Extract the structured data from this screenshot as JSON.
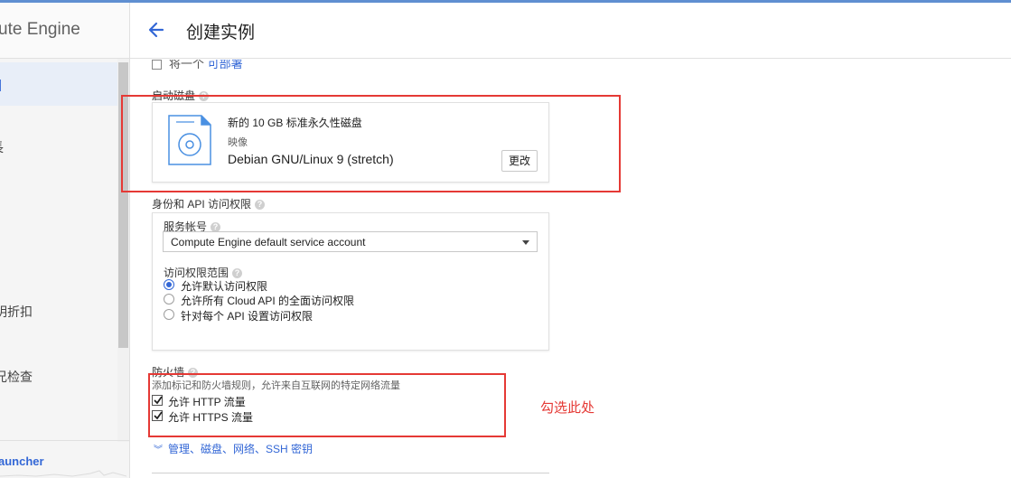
{
  "sidebar": {
    "title": "ute Engine",
    "items": [
      {
        "label": "]"
      },
      {
        "label": "長"
      },
      {
        "label": "明折扣"
      },
      {
        "label": "兄检查"
      }
    ],
    "launcher": "auncher"
  },
  "header": {
    "title": "创建实例"
  },
  "truncated_row": {
    "text": "将一个 ",
    "link": "可部署"
  },
  "boot_disk": {
    "label": "启动磁盘",
    "description": "新的 10 GB 标准永久性磁盘",
    "image_label": "映像",
    "image_name": "Debian GNU/Linux 9 (stretch)",
    "change_button": "更改"
  },
  "identity": {
    "label": "身份和 API 访问权限",
    "service_account_label": "服务帐号",
    "service_account_value": "Compute Engine default service account",
    "scope_label": "访问权限范围",
    "scopes": [
      {
        "label": "允许默认访问权限",
        "selected": true
      },
      {
        "label": "允许所有 Cloud API 的全面访问权限",
        "selected": false
      },
      {
        "label": "针对每个 API 设置访问权限",
        "selected": false
      }
    ]
  },
  "firewall": {
    "label": "防火墙",
    "description": "添加标记和防火墙规则，允许来自互联网的特定网络流量",
    "options": [
      {
        "label": "允许 HTTP 流量",
        "checked": true
      },
      {
        "label": "允许 HTTPS 流量",
        "checked": true
      }
    ]
  },
  "more_link": "管理、磁盘、网络、SSH 密钥",
  "annotation": {
    "text": "勾选此处",
    "color": "#e53935"
  },
  "colors": {
    "accent": "#3367d6",
    "annotation_red": "#e53935"
  }
}
